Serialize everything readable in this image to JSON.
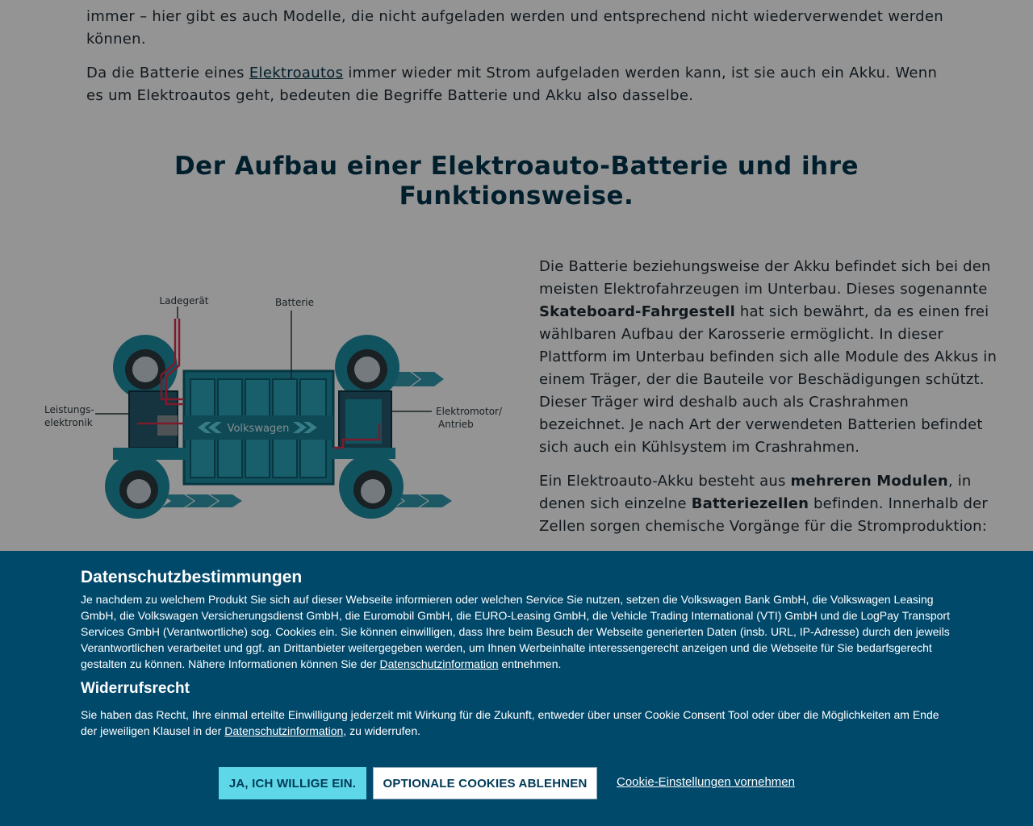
{
  "article": {
    "intro_p1": "immer – hier gibt es auch Modelle, die nicht aufgeladen werden und entsprechend nicht wiederverwendet werden können.",
    "intro_p2_a": "Da die Batterie eines ",
    "intro_p2_link": "Elektroautos",
    "intro_p2_b": " immer wieder mit Strom aufgeladen werden kann, ist sie auch ein Akku. Wenn es um Elektroautos geht, bedeuten die Begriffe Batterie und Akku also dasselbe.",
    "section_heading": "Der Aufbau einer Elektroauto-Batterie und ihre Funktionsweise.",
    "figure_labels": {
      "ladegeraet": "Ladegerät",
      "batterie": "Batterie",
      "leistung_1": "Leistungs-",
      "leistung_2": "elektronik",
      "motor_1": "Elektromotor/",
      "motor_2": "Antrieb",
      "brand": "Volkswagen"
    },
    "right_p1_a": "Die Batterie beziehungsweise der Akku befindet sich bei den meisten Elektrofahrzeugen im Unterbau. Dieses sogenannte ",
    "right_p1_bold": "Skateboard-Fahrgestell",
    "right_p1_b": " hat sich bewährt, da es einen frei wählbaren Aufbau der Karosserie ermöglicht. In dieser Plattform im Unterbau befinden sich alle Module des Akkus in einem Träger, der die Bauteile vor Beschädigungen schützt. Dieser Träger wird deshalb auch als Crashrahmen bezeichnet. Je nach Art der verwendeten Batterien befindet sich auch ein Kühlsystem im Crashrahmen.",
    "right_p2_a": "Ein Elektroauto-Akku besteht aus ",
    "right_p2_bold1": "mehreren Modulen",
    "right_p2_b": ", in denen sich einzelne ",
    "right_p2_bold2": "Batteriezellen",
    "right_p2_c": " befinden. Innerhalb der Zellen sorgen chemische Vorgänge für die Stromproduktion:"
  },
  "cookie_banner": {
    "title": "Datenschutzbestimmungen",
    "text_a": "Je nachdem zu welchem Produkt Sie sich auf dieser Webseite informieren oder welchen Service Sie nutzen, setzen die Volkswagen Bank GmbH, die Volkswagen Leasing GmbH, die Volkswagen Versicherungsdienst GmbH, die Euromobil GmbH, die EURO-Leasing GmbH, die Vehicle Trading International (VTI) GmbH und die LogPay Transport Services GmbH (Verantwortliche) sog. Cookies ein. Sie können einwilligen, dass Ihre beim Besuch der Webseite generierten Daten (insb. URL, IP-Adresse) durch den jeweils Verantwortlichen verarbeitet und ggf. an Drittanbieter weitergegeben werden, um Ihnen Werbeinhalte interessengerecht anzeigen und die Webseite für Sie bedarfsgerecht gestalten zu können. Nähere Informationen können Sie der ",
    "link1": "Datenschutzinformation",
    "text_b": " entnehmen.",
    "title2": "Widerrufsrecht",
    "text2_a": "Sie haben das Recht, Ihre einmal erteilte Einwilligung jederzeit mit Wirkung für die Zukunft, entweder über unser Cookie Consent Tool oder über die Möglichkeiten am Ende der jeweiligen Klausel in der ",
    "link2": "Datenschutzinformation",
    "text2_b": ", zu widerrufen.",
    "accept_label": "JA, ICH WILLIGE EIN.",
    "reject_label": "OPTIONALE COOKIES ABLEHNEN",
    "settings_label": "Cookie-Einstellungen vornehmen"
  },
  "colors": {
    "heading": "#00354d",
    "banner_bg": "#00496b",
    "accept_bg": "#5ed7e8",
    "teal": "#1e8ea4"
  }
}
